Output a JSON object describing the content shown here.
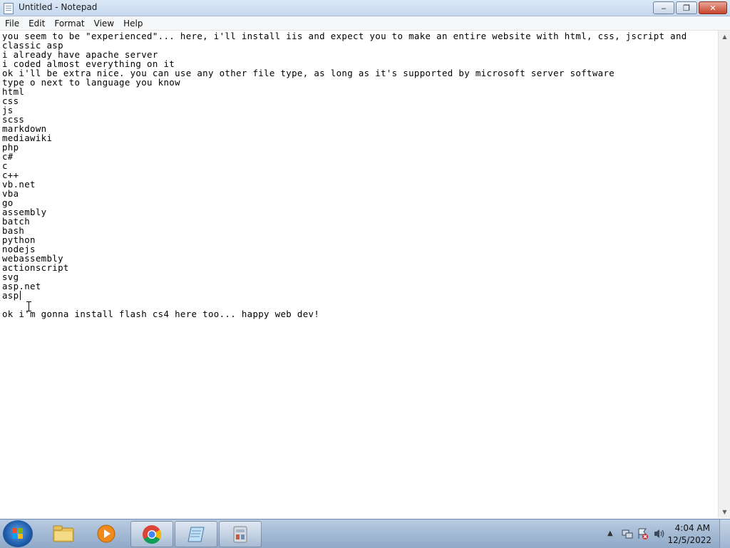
{
  "window": {
    "title": "Untitled - Notepad",
    "controls": {
      "minimize": "‒",
      "maximize": "❐",
      "close": "✕"
    }
  },
  "menu": [
    "File",
    "Edit",
    "Format",
    "View",
    "Help"
  ],
  "editor": {
    "lines": [
      "you seem to be \"experienced\"... here, i'll install iis and expect you to make an entire website with html, css, jscript and",
      "classic asp",
      "i already have apache server",
      "i coded almost everything on it",
      "ok i'll be extra nice. you can use any other file type, as long as it's supported by microsoft server software",
      "type o next to language you know",
      "html",
      "css",
      "js",
      "scss",
      "markdown",
      "mediawiki",
      "php",
      "c#",
      "c",
      "c++",
      "vb.net",
      "vba",
      "go",
      "assembly",
      "batch",
      "bash",
      "python",
      "nodejs",
      "webassembly",
      "actionscript",
      "svg",
      "asp.net",
      "asp",
      "",
      "ok i'm gonna install flash cs4 here too... happy web dev!"
    ]
  },
  "taskbar": {
    "pinned": [
      "start-button",
      "explorer",
      "media-player",
      "chrome",
      "notepad",
      "control-panel"
    ],
    "clock": {
      "time": "4:04 AM",
      "date": "12/5/2022"
    },
    "tray_icons": [
      "show-hidden-icons",
      "network-icon",
      "action-center-icon",
      "volume-icon"
    ]
  },
  "colors": {
    "title_bar": "#c9daf0",
    "taskbar": "#a3bad6",
    "close_button": "#c7432c"
  }
}
